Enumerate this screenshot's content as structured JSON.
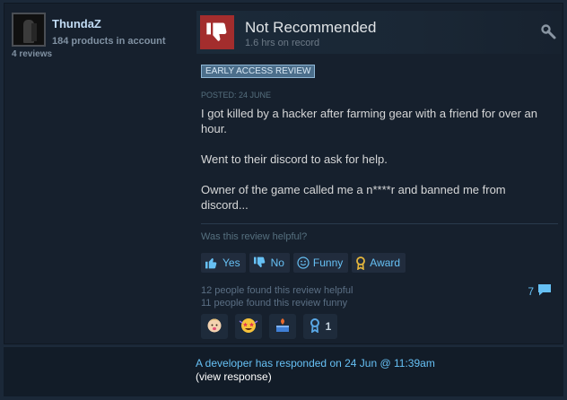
{
  "author": {
    "name": "ThundaZ",
    "products": "184 products in account",
    "reviews": "4 reviews"
  },
  "review": {
    "recommendation": "Not Recommended",
    "hours": "1.6 hrs on record",
    "badge": "EARLY ACCESS REVIEW",
    "posted": "POSTED: 24 JUNE",
    "paragraphs": [
      "I got killed by a hacker after farming gear with a friend for over an hour.",
      "Went to their discord to ask for help.",
      "Owner of the game called me a n****r and banned me from discord..."
    ]
  },
  "feedback": {
    "question": "Was this review helpful?",
    "yes_label": "Yes",
    "no_label": "No",
    "funny_label": "Funny",
    "award_label": "Award",
    "helpful_count": "12 people found this review helpful",
    "funny_count": "11 people found this review funny",
    "comment_count": "7",
    "award_badge_count": "1"
  },
  "icons": {
    "thumb": "thumbs-down-icon",
    "corner": "award-wrench-icon",
    "yes": "thumbs-up-icon",
    "no": "thumbs-down-icon",
    "funny": "smiley-icon",
    "award": "award-ribbon-icon",
    "comment": "comment-icon",
    "awards": [
      "baby-face-icon",
      "starstruck-face-icon",
      "trophy-cake-icon",
      "ribbon-medal-icon"
    ]
  },
  "developer_response": {
    "line": "A developer has responded on 24 Jun @ 11:39am",
    "view": "(view response)"
  },
  "colors": {
    "background": "#1b2838",
    "card": "#16202d",
    "thumb_down": "#a32d2d",
    "link": "#66c0f4",
    "badge_bg": "#4b6e8b"
  }
}
